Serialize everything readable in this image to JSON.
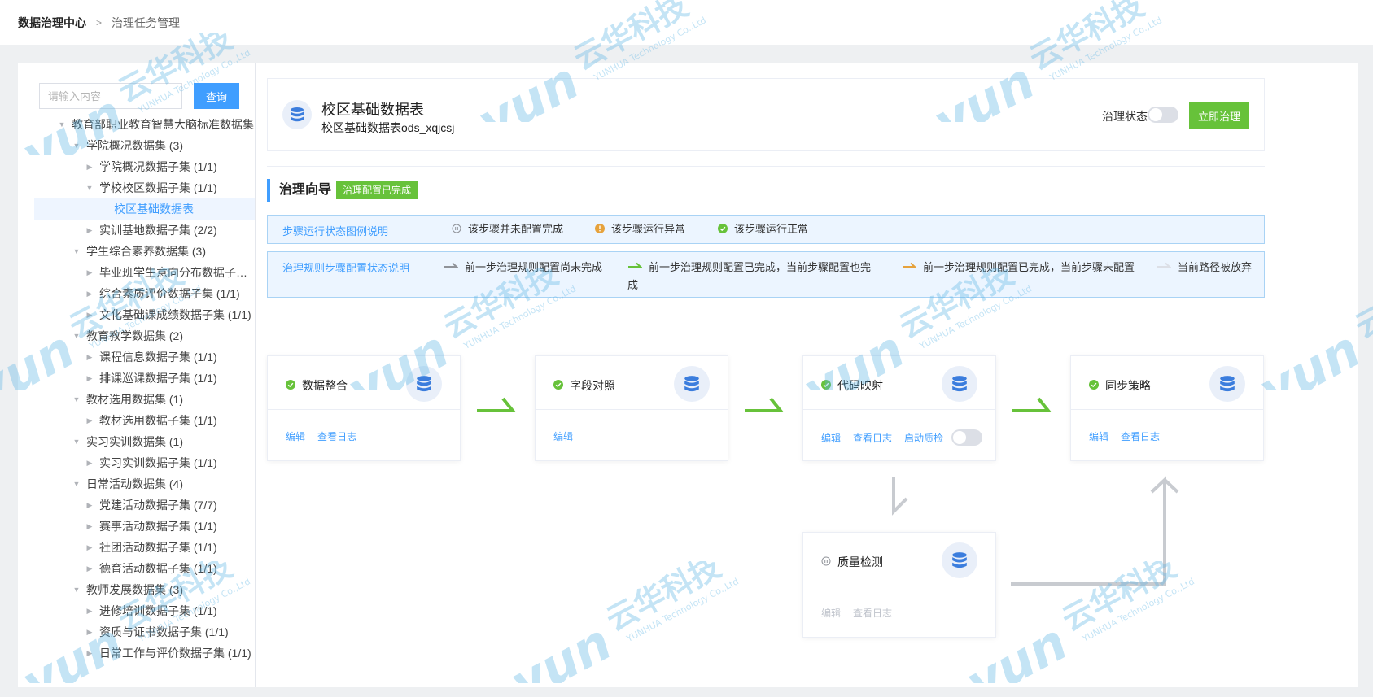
{
  "breadcrumb": {
    "home": "数据治理中心",
    "separator": ">",
    "current": "治理任务管理"
  },
  "search": {
    "placeholder": "请输入内容",
    "button": "查询"
  },
  "tree": [
    {
      "level": 0,
      "expanded": true,
      "label": "教育部职业教育智慧大脑标准数据集"
    },
    {
      "level": 1,
      "expanded": true,
      "label": "学院概况数据集 (3)"
    },
    {
      "level": 2,
      "expanded": false,
      "label": "学院概况数据子集 (1/1)"
    },
    {
      "level": 2,
      "expanded": true,
      "label": "学校校区数据子集 (1/1)"
    },
    {
      "level": 3,
      "leaf": true,
      "selected": true,
      "label": "校区基础数据表"
    },
    {
      "level": 2,
      "expanded": false,
      "label": "实训基地数据子集 (2/2)"
    },
    {
      "level": 1,
      "expanded": true,
      "label": "学生综合素养数据集 (3)"
    },
    {
      "level": 2,
      "expanded": false,
      "label": "毕业班学生意向分布数据子集 (3/3)"
    },
    {
      "level": 2,
      "expanded": false,
      "label": "综合素质评价数据子集 (1/1)"
    },
    {
      "level": 2,
      "expanded": false,
      "label": "文化基础课成绩数据子集 (1/1)"
    },
    {
      "level": 1,
      "expanded": true,
      "label": "教育教学数据集 (2)"
    },
    {
      "level": 2,
      "expanded": false,
      "label": "课程信息数据子集 (1/1)"
    },
    {
      "level": 2,
      "expanded": false,
      "label": "排课巡课数据子集 (1/1)"
    },
    {
      "level": 1,
      "expanded": true,
      "label": "教材选用数据集 (1)"
    },
    {
      "level": 2,
      "expanded": false,
      "label": "教材选用数据子集 (1/1)"
    },
    {
      "level": 1,
      "expanded": true,
      "label": "实习实训数据集 (1)"
    },
    {
      "level": 2,
      "expanded": false,
      "label": "实习实训数据子集 (1/1)"
    },
    {
      "level": 1,
      "expanded": true,
      "label": "日常活动数据集 (4)"
    },
    {
      "level": 2,
      "expanded": false,
      "label": "党建活动数据子集 (7/7)"
    },
    {
      "level": 2,
      "expanded": false,
      "label": "赛事活动数据子集 (1/1)"
    },
    {
      "level": 2,
      "expanded": false,
      "label": "社团活动数据子集 (1/1)"
    },
    {
      "level": 2,
      "expanded": false,
      "label": "德育活动数据子集 (1/1)"
    },
    {
      "level": 1,
      "expanded": true,
      "label": "教师发展数据集 (3)"
    },
    {
      "level": 2,
      "expanded": false,
      "label": "进修培训数据子集 (1/1)"
    },
    {
      "level": 2,
      "expanded": false,
      "label": "资质与证书数据子集 (1/1)"
    },
    {
      "level": 2,
      "expanded": false,
      "label": "日常工作与评价数据子集 (1/1)"
    }
  ],
  "header": {
    "title": "校区基础数据表",
    "subtitle": "校区基础数据表ods_xqjcsj",
    "status_label": "治理状态",
    "status_on": false,
    "action_button": "立即治理"
  },
  "guide": {
    "title": "治理向导",
    "badge": "治理配置已完成"
  },
  "legend_status": {
    "title": "步骤运行状态图例说明",
    "items": [
      {
        "icon": "pause-circle-icon",
        "text": "该步骤并未配置完成"
      },
      {
        "icon": "warning-circle-icon",
        "text": "该步骤运行异常"
      },
      {
        "icon": "check-circle-icon",
        "text": "该步骤运行正常"
      }
    ]
  },
  "legend_rules": {
    "title": "治理规则步骤配置状态说明",
    "items": [
      {
        "icon": "arrow-gray-icon",
        "color": "#909399",
        "text": "前一步治理规则配置尚未完成"
      },
      {
        "icon": "arrow-green-icon",
        "color": "#67c23a",
        "text": "前一步治理规则配置已完成，当前步骤配置也完成"
      },
      {
        "icon": "arrow-orange-icon",
        "color": "#e6a23c",
        "text": "前一步治理规则配置已完成，当前步骤未配置"
      },
      {
        "icon": "arrow-lightgray-icon",
        "color": "#dcdfe6",
        "text": "当前路径被放弃"
      }
    ]
  },
  "steps": {
    "integrate": {
      "title": "数据整合",
      "status": "ok",
      "actions": [
        "编辑",
        "查看日志"
      ]
    },
    "field_map": {
      "title": "字段对照",
      "status": "ok",
      "actions": [
        "编辑"
      ]
    },
    "code_map": {
      "title": "代码映射",
      "status": "ok",
      "actions": [
        "编辑",
        "查看日志",
        "启动质检"
      ],
      "quality_check_on": false
    },
    "sync": {
      "title": "同步策略",
      "status": "ok",
      "actions": [
        "编辑",
        "查看日志"
      ]
    },
    "quality": {
      "title": "质量检测",
      "status": "pending",
      "actions": [
        "编辑",
        "查看日志"
      ]
    }
  },
  "colors": {
    "primary": "#409eff",
    "success": "#67c23a",
    "warning": "#e6a23c",
    "abandoned": "#dcdfe6",
    "watermark": "#5ab4e5"
  },
  "watermark": {
    "brand": "云华科技",
    "en": "YUNHUA Technology Co.,Ltd"
  }
}
